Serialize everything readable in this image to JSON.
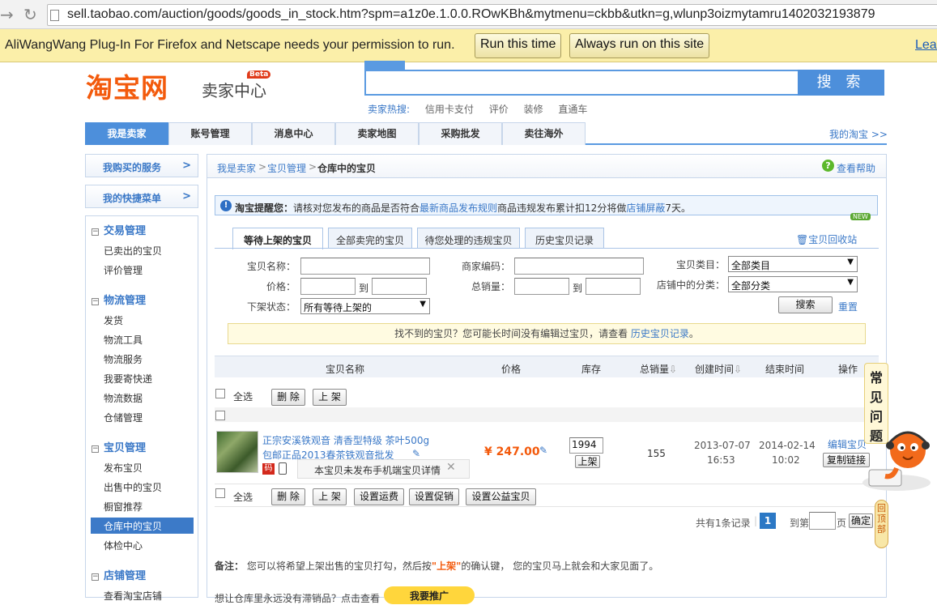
{
  "browser": {
    "url": "sell.taobao.com/auction/goods/goods_in_stock.htm?spm=a1z0e.1.0.0.ROwKBh&mytmenu=ckbb&utkn=g,wlunp3oizmytamru1402032193879"
  },
  "plugin_bar": {
    "message": "AliWangWang Plug-In For Firefox and Netscape needs your permission to run.",
    "run_once": "Run this time",
    "run_always": "Always run on this site",
    "learn": "Lear"
  },
  "header": {
    "logo": "淘宝网",
    "logo_sub": "卖家中心",
    "beta": "Beta",
    "search_button": "搜 索",
    "hot_label": "卖家热搜:",
    "hot_items": [
      "信用卡支付",
      "评价",
      "装修",
      "直通车"
    ]
  },
  "topnav": {
    "tabs": [
      "我是卖家",
      "账号管理",
      "消息中心",
      "卖家地图",
      "采购批发",
      "卖往海外"
    ],
    "my_taobao": "我的淘宝 >>"
  },
  "sidebar": {
    "box1": "我购买的服务",
    "box2": "我的快捷菜单",
    "arrow": ">",
    "sections": [
      {
        "title": "交易管理",
        "items": [
          "已卖出的宝贝",
          "评价管理"
        ]
      },
      {
        "title": "物流管理",
        "items": [
          "发货",
          "物流工具",
          "物流服务",
          "我要寄快递",
          "物流数据",
          "仓储管理"
        ]
      },
      {
        "title": "宝贝管理",
        "items": [
          "发布宝贝",
          "出售中的宝贝",
          "橱窗推荐",
          "仓库中的宝贝",
          "体检中心"
        ]
      },
      {
        "title": "店铺管理",
        "items": [
          "查看淘宝店铺"
        ]
      }
    ],
    "collapse_symbol": "−"
  },
  "breadcrumb": {
    "items": [
      "我是卖家",
      "宝贝管理",
      "仓库中的宝贝"
    ],
    "sep": ">",
    "help": "查看帮助"
  },
  "reminder": {
    "label": "淘宝提醒您：",
    "text1": "请核对您发布的商品是否符合",
    "link1": "最新商品发布规则",
    "text2": "商品违规发布累计扣12分将做",
    "link2": "店铺屏蔽",
    "text3": "7天。",
    "new_badge": "NEW"
  },
  "tabs": [
    "等待上架的宝贝",
    "全部卖完的宝贝",
    "待您处理的违规宝贝",
    "历史宝贝记录"
  ],
  "recycle": "宝贝回收站",
  "filters": {
    "name_label": "宝贝名称：",
    "code_label": "商家编码：",
    "category_label": "宝贝类目：",
    "category_value": "全部类目",
    "price_label": "价格：",
    "to": "到",
    "sales_label": "总销量：",
    "shop_cat_label": "店铺中的分类：",
    "shop_cat_value": "全部分类",
    "status_label": "下架状态：",
    "status_value": "所有等待上架的",
    "search": "搜索",
    "reset": "重置"
  },
  "notfound": {
    "text": "找不到的宝贝？您可能长时间没有编辑过宝贝，请查看",
    "link": "历史宝贝记录",
    "end": "。"
  },
  "table": {
    "headers": [
      "宝贝名称",
      "价格",
      "库存",
      "总销量",
      "创建时间",
      "结束时间",
      "操作"
    ],
    "select_all": "全选",
    "delete": "删 除",
    "shelve": "上 架",
    "set_shipping": "设置运费",
    "set_promo": "设置促销",
    "set_charity": "设置公益宝贝"
  },
  "item": {
    "title_line1": "正宗安溪铁观音 清香型特级 茶叶500g",
    "title_line2": "包邮正品2013春茶铁观音批发",
    "price": "¥ 247.00",
    "stock": "1994",
    "shelve_btn": "上架",
    "sales": "155",
    "created_date": "2013-07-07",
    "created_time": "16:53",
    "end_date": "2014-02-14",
    "end_time": "10:02",
    "edit": "编辑宝贝",
    "copy_link": "复制链接",
    "tooltip": "本宝贝未发布手机端宝贝详情",
    "tag": "码"
  },
  "pager": {
    "total": "共有1条记录",
    "page": "1",
    "goto": "到第",
    "unit": "页",
    "confirm": "确定"
  },
  "note": {
    "label": "备注：",
    "text1": "您可以将希望上架出售的宝贝打勾，然后按",
    "highlight": "\"上架\"",
    "text2": "的确认键， 您的宝贝马上就会和大家见面了。"
  },
  "bottom": {
    "text": "想让仓库里永远没有滞销品？点击查看",
    "promo": "我要推广"
  },
  "faq": "常见问题",
  "backtop": "回顶部"
}
